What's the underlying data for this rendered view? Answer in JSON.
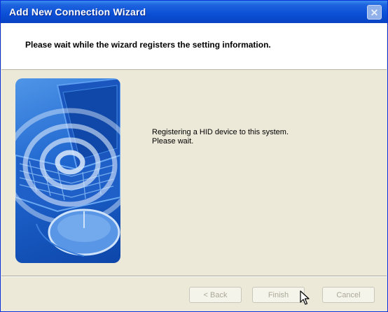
{
  "window": {
    "title": "Add New Connection Wizard",
    "close_glyph": "✕"
  },
  "header": {
    "text": "Please wait while the wizard registers the setting information."
  },
  "content": {
    "line1": "Registering a HID device to this system.",
    "line2": "Please wait."
  },
  "buttons": {
    "back": "< Back",
    "finish": "Finish",
    "cancel": "Cancel"
  },
  "icons": {
    "wizard_art": "wizard-laptop-mouse-signal-illustration",
    "cursor": "arrow-pointer"
  },
  "colors": {
    "titlebar": "#0a4fd6",
    "dialog_bg": "#ece9d8",
    "art_blue": "#1f66cf",
    "disabled_text": "#aca899"
  }
}
